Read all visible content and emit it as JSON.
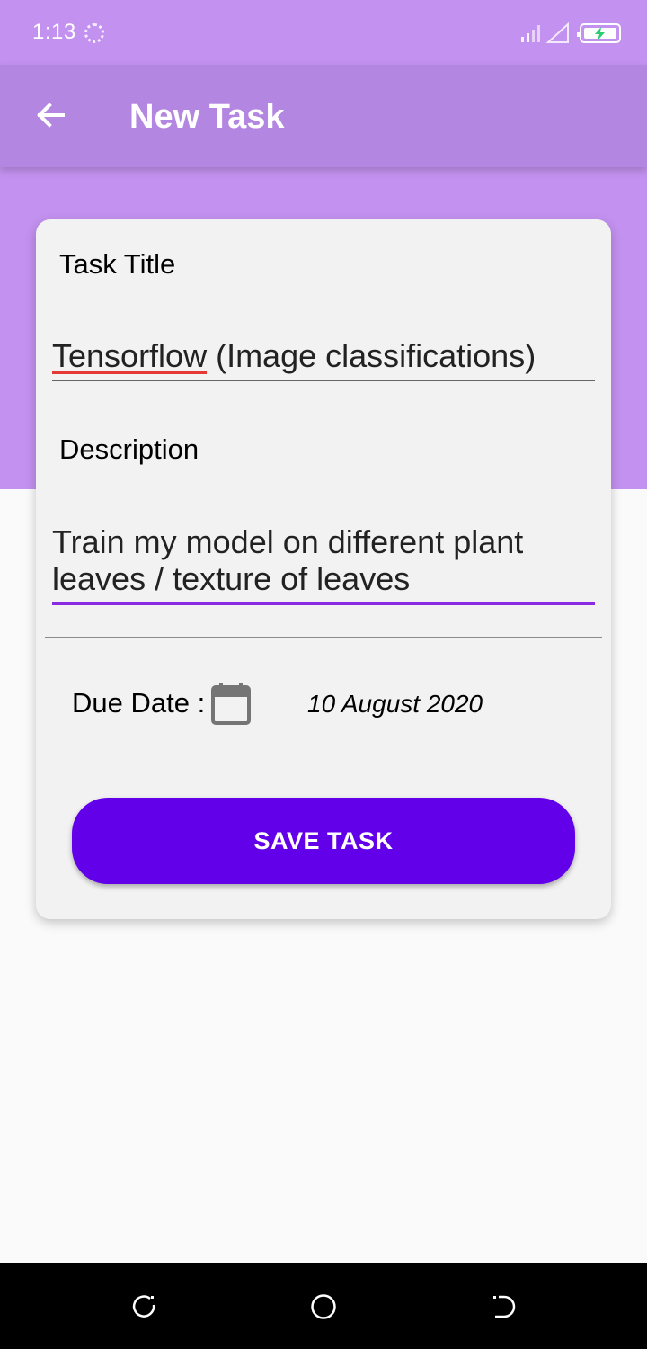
{
  "status_bar": {
    "time": "1:13"
  },
  "app_bar": {
    "title": "New Task"
  },
  "form": {
    "title_label": "Task Title",
    "title_value_misspelled": "Tensorflow",
    "title_value_rest": " (Image classifications)",
    "description_label": "Description",
    "description_line1": "Train my model on different plant",
    "description_line2": "leaves / texture of leaves",
    "due_label": "Due Date :",
    "due_value": "10 August 2020",
    "save_label": "SAVE TASK"
  },
  "colors": {
    "status_bar": "#c391ef",
    "app_bar": "#b286e1",
    "card": "#f2f2f2",
    "button": "#6200ea",
    "focus_underline": "#8a2be2",
    "background": "#fafafa"
  },
  "icons": [
    "spinner-icon",
    "signal-icon",
    "battery-icon",
    "back-arrow-icon",
    "calendar-icon",
    "recents-icon",
    "home-icon",
    "back-nav-icon"
  ]
}
